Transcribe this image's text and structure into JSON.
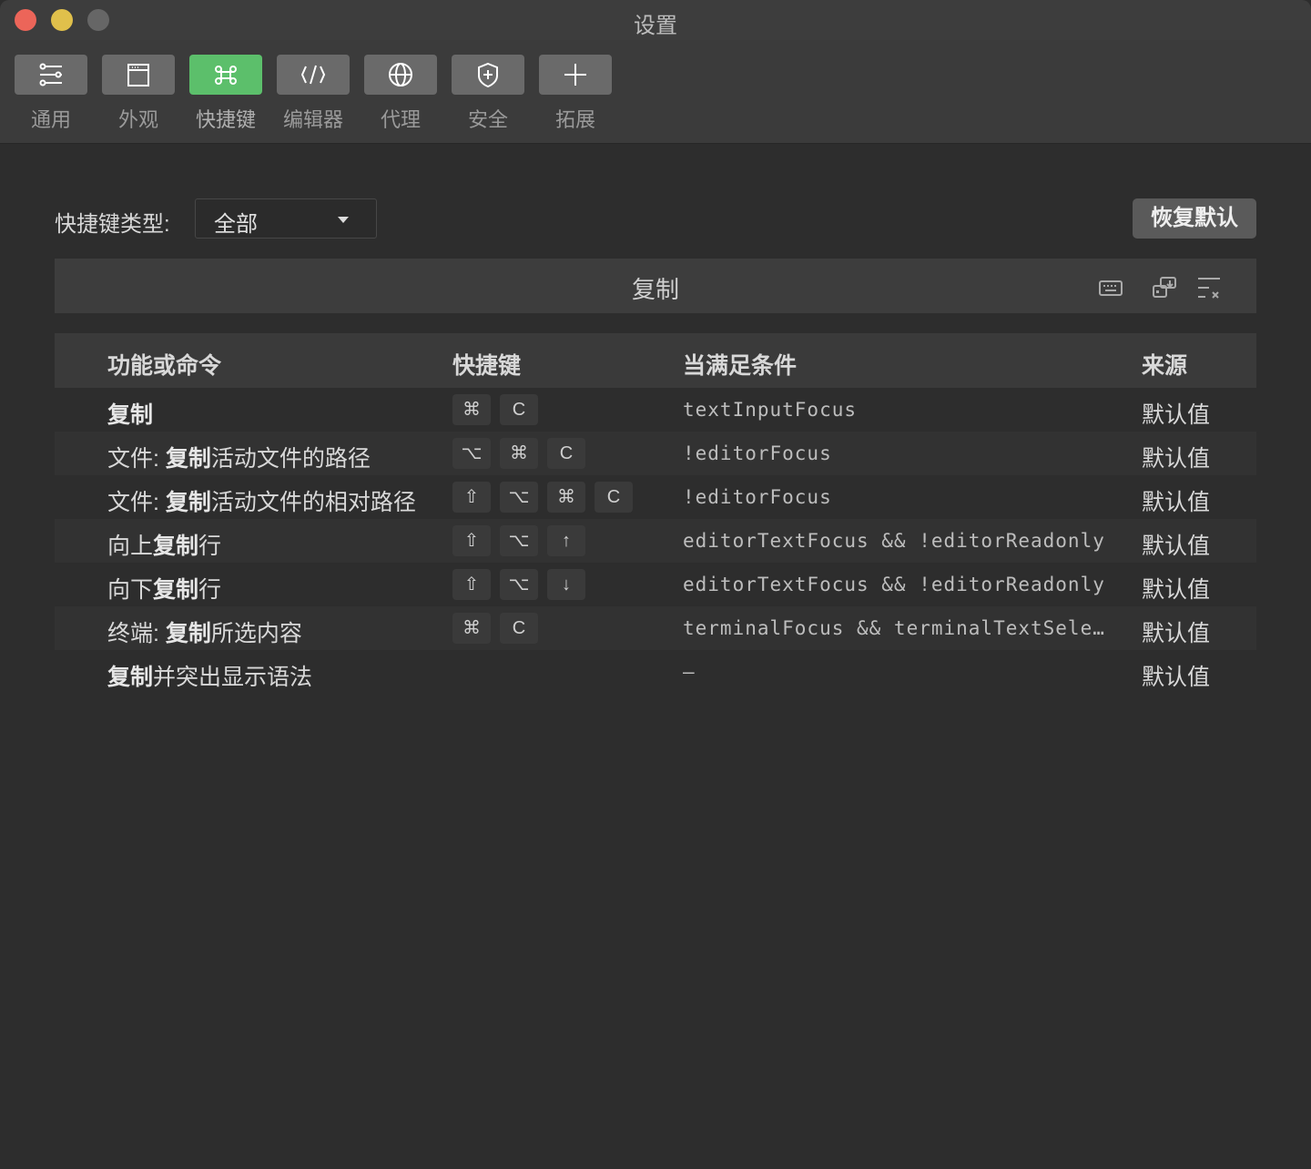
{
  "window": {
    "title": "设置",
    "accent": "#5cbf6b"
  },
  "toolbar": [
    {
      "label": "通用",
      "icon": "sliders-icon"
    },
    {
      "label": "外观",
      "icon": "window-icon"
    },
    {
      "label": "快捷键",
      "icon": "command-icon",
      "active": true
    },
    {
      "label": "编辑器",
      "icon": "code-icon"
    },
    {
      "label": "代理",
      "icon": "globe-icon"
    },
    {
      "label": "安全",
      "icon": "shield-icon"
    },
    {
      "label": "拓展",
      "icon": "plus-icon"
    }
  ],
  "filter": {
    "label": "快捷键类型:",
    "value": "全部"
  },
  "reset_label": "恢复默认",
  "search": {
    "query": "复制"
  },
  "table": {
    "headers": {
      "command": "功能或命令",
      "keys": "快捷键",
      "when": "当满足条件",
      "source": "来源"
    },
    "rows": [
      {
        "pre": "",
        "bold": "复制",
        "post": "",
        "keys": [
          "⌘",
          "C"
        ],
        "when": "textInputFocus",
        "source": "默认值"
      },
      {
        "pre": "文件: ",
        "bold": "复制",
        "post": "活动文件的路径",
        "keys": [
          "⌥",
          "⌘",
          "C"
        ],
        "when": "!editorFocus",
        "source": "默认值"
      },
      {
        "pre": "文件: ",
        "bold": "复制",
        "post": "活动文件的相对路径",
        "keys": [
          "⇧",
          "⌥",
          "⌘",
          "C"
        ],
        "when": "!editorFocus",
        "source": "默认值"
      },
      {
        "pre": "向上",
        "bold": "复制",
        "post": "行",
        "keys": [
          "⇧",
          "⌥",
          "↑"
        ],
        "when": "editorTextFocus && !editorReadonly",
        "source": "默认值"
      },
      {
        "pre": "向下",
        "bold": "复制",
        "post": "行",
        "keys": [
          "⇧",
          "⌥",
          "↓"
        ],
        "when": "editorTextFocus && !editorReadonly",
        "source": "默认值"
      },
      {
        "pre": "终端: ",
        "bold": "复制",
        "post": "所选内容",
        "keys": [
          "⌘",
          "C"
        ],
        "when": "terminalFocus && terminalTextSele…",
        "source": "默认值"
      },
      {
        "pre": "",
        "bold": "复制",
        "post": "并突出显示语法",
        "keys": [],
        "when": "—",
        "source": "默认值"
      }
    ]
  }
}
